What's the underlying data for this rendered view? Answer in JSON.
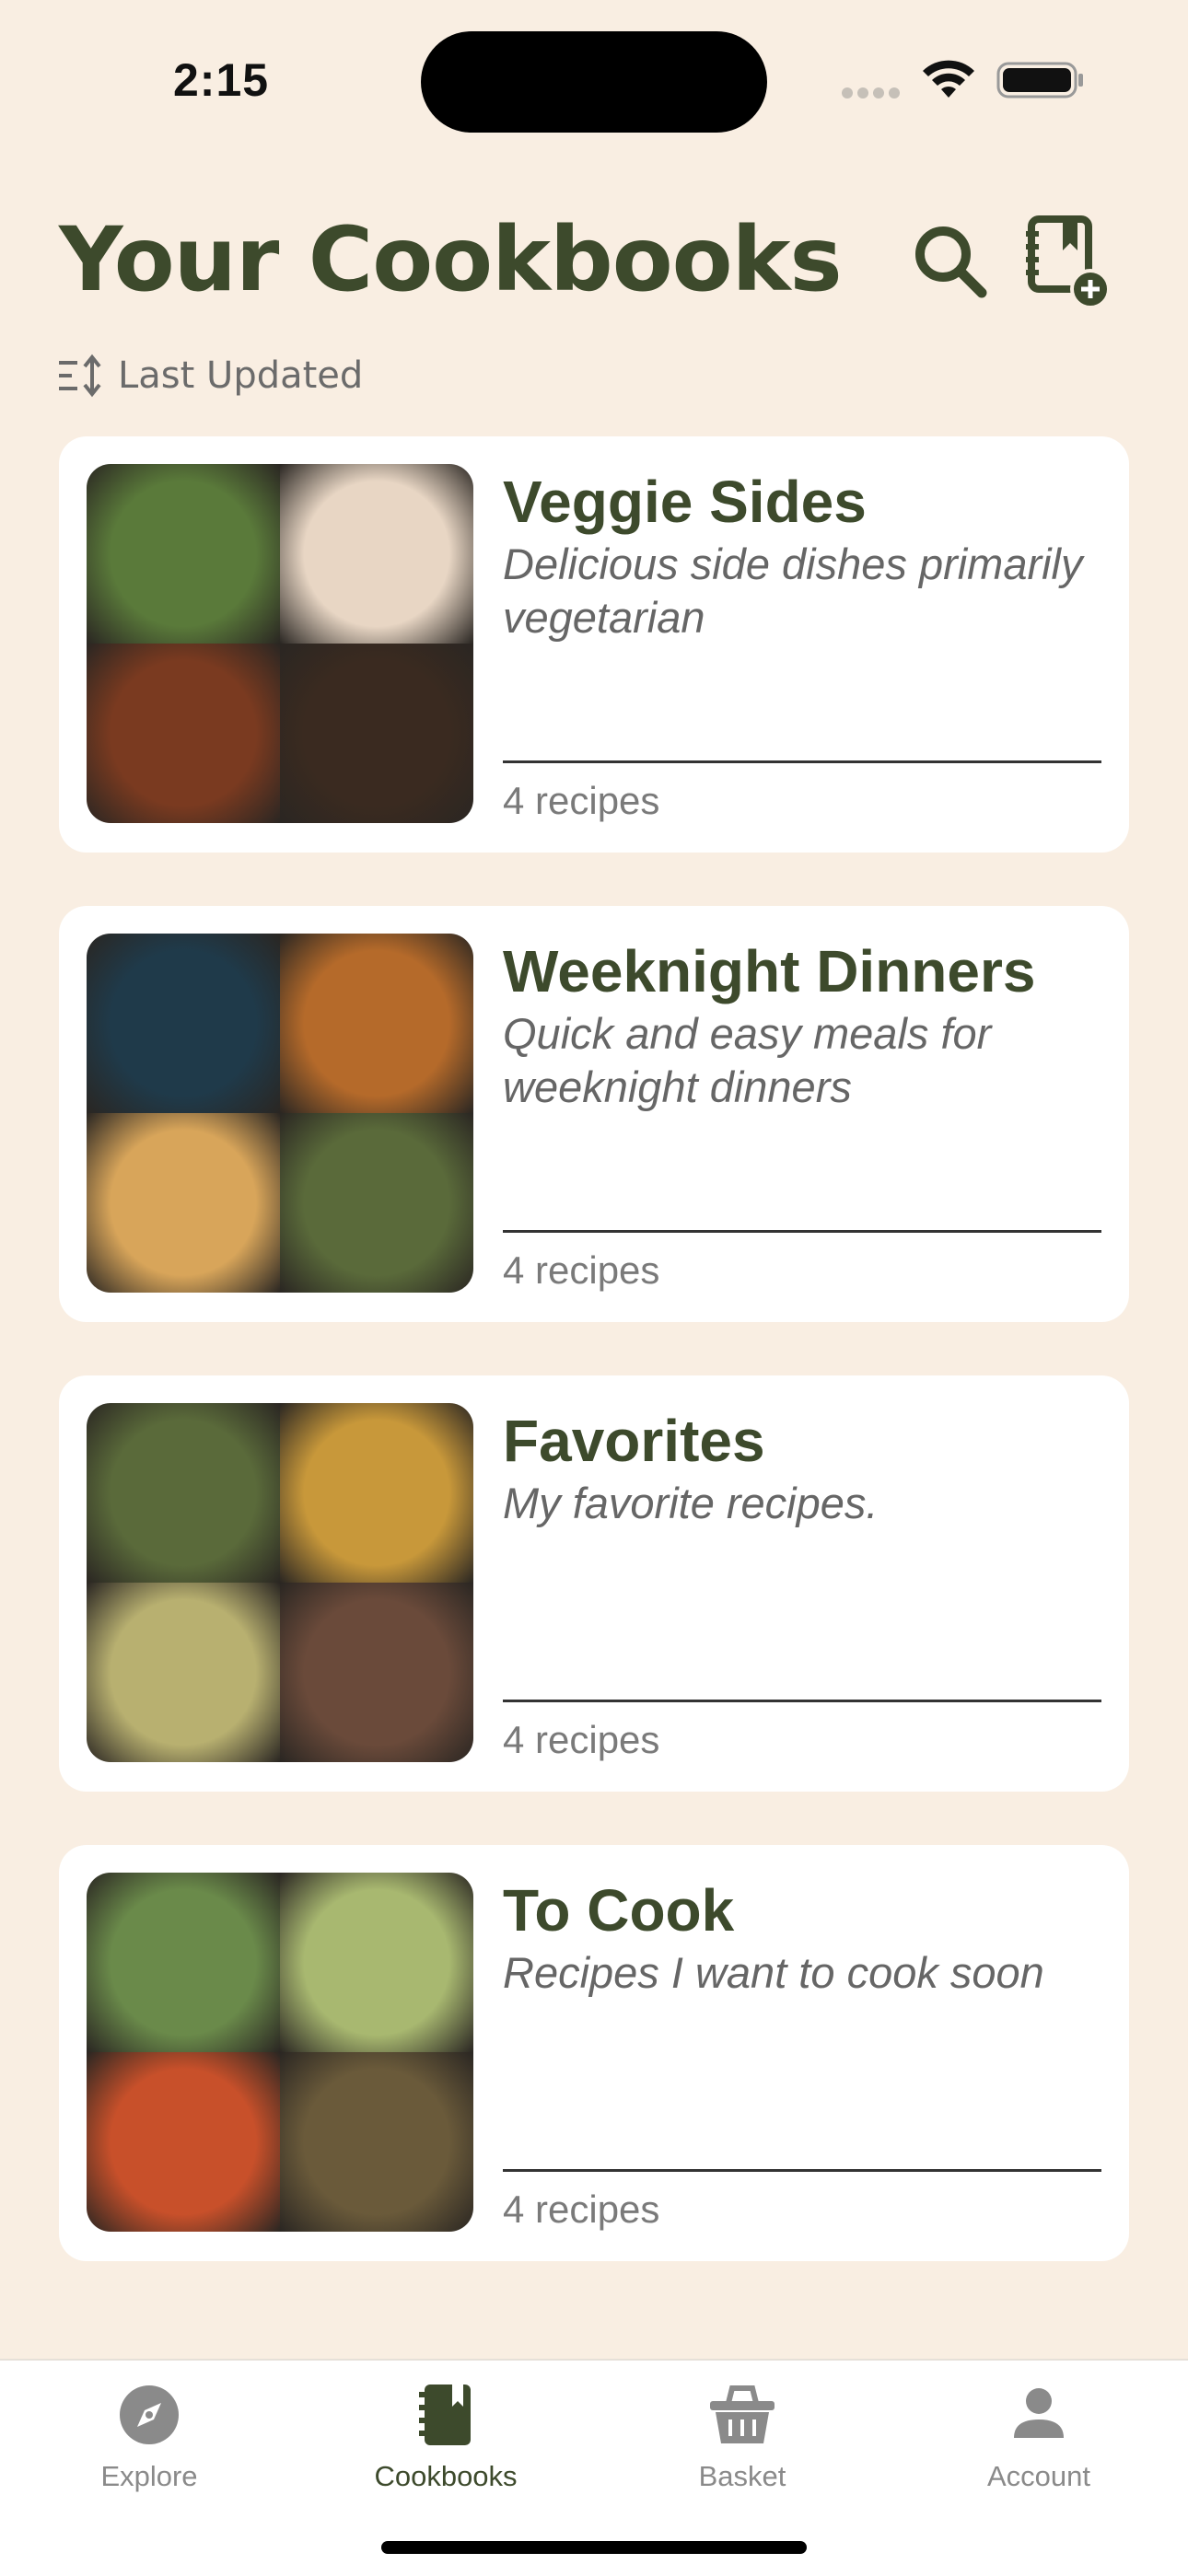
{
  "status_bar": {
    "time": "2:15"
  },
  "header": {
    "title": "Your Cookbooks",
    "sort_label": "Last Updated"
  },
  "cookbooks": [
    {
      "title": "Veggie Sides",
      "description": "Delicious side dishes primarily vegetarian",
      "count_label": "4 recipes",
      "photo_colors": [
        "#5a7a3a",
        "#e8d6c4",
        "#7a3a20",
        "#3a2a20"
      ]
    },
    {
      "title": "Weeknight Dinners",
      "description": "Quick and easy meals for weeknight dinners",
      "count_label": "4 recipes",
      "photo_colors": [
        "#1f3a4a",
        "#b56a2a",
        "#d8a55a",
        "#5a6a3a"
      ]
    },
    {
      "title": "Favorites",
      "description": "My favorite recipes.",
      "count_label": "4 recipes",
      "photo_colors": [
        "#5a6a3a",
        "#c8983a",
        "#b8b070",
        "#6a4a3a"
      ]
    },
    {
      "title": "To Cook",
      "description": "Recipes I want to cook soon",
      "count_label": "4 recipes",
      "photo_colors": [
        "#6a8a4a",
        "#a8b870",
        "#c8502a",
        "#6a5a3a"
      ]
    }
  ],
  "tabs": [
    {
      "label": "Explore",
      "icon": "compass-icon",
      "active": false
    },
    {
      "label": "Cookbooks",
      "icon": "cookbook-icon",
      "active": true
    },
    {
      "label": "Basket",
      "icon": "basket-icon",
      "active": false
    },
    {
      "label": "Account",
      "icon": "person-icon",
      "active": false
    }
  ],
  "colors": {
    "background": "#f9eee2",
    "accent": "#3d4a2c",
    "card": "#ffffff"
  }
}
